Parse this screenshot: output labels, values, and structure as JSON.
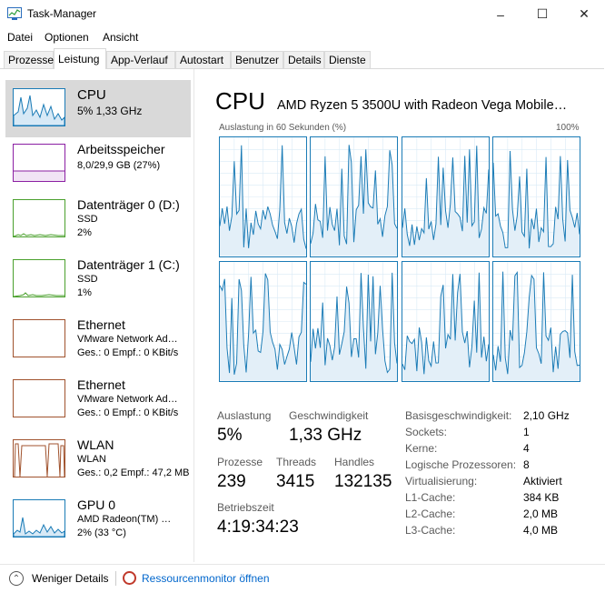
{
  "window": {
    "title": "Task-Manager",
    "controls": [
      "–",
      "☐",
      "✕"
    ]
  },
  "menu": [
    {
      "label": "Datei",
      "access": "D"
    },
    {
      "label": "Optionen",
      "access": "O"
    },
    {
      "label": "Ansicht",
      "access": "A"
    }
  ],
  "tabs": [
    {
      "label": "Prozesse"
    },
    {
      "label": "Leistung",
      "active": true
    },
    {
      "label": "App-Verlauf"
    },
    {
      "label": "Autostart"
    },
    {
      "label": "Benutzer"
    },
    {
      "label": "Details"
    },
    {
      "label": "Dienste"
    }
  ],
  "devices": [
    {
      "title": "CPU",
      "line1": "5% 1,33 GHz",
      "line2": "",
      "color": "#1a7bb6",
      "fill": "#e6f1f9",
      "selected": true
    },
    {
      "title": "Arbeitsspeicher",
      "line1": "8,0/29,9 GB (27%)",
      "line2": "",
      "color": "#8b1fa3",
      "fill": "#f3e5f6"
    },
    {
      "title": "Datenträger 0 (D:)",
      "line1": "SSD",
      "line2": "2%",
      "color": "#4aa02c",
      "fill": "#eef7ea"
    },
    {
      "title": "Datenträger 1 (C:)",
      "line1": "SSD",
      "line2": "1%",
      "color": "#4aa02c",
      "fill": "#eef7ea"
    },
    {
      "title": "Ethernet",
      "line1": "VMware Network Ad…",
      "line2": "Ges.: 0 Empf.: 0 KBit/s",
      "color": "#a0522d",
      "fill": "#fff"
    },
    {
      "title": "Ethernet",
      "line1": "VMware Network Ad…",
      "line2": "Ges.: 0 Empf.: 0 KBit/s",
      "color": "#a0522d",
      "fill": "#fff"
    },
    {
      "title": "WLAN",
      "line1": "WLAN",
      "line2": "Ges.: 0,2 Empf.: 47,2 MB",
      "color": "#a0522d",
      "fill": "#fff"
    },
    {
      "title": "GPU 0",
      "line1": "AMD Radeon(TM) …",
      "line2": "2% (33 °C)",
      "color": "#1a7bb6",
      "fill": "#e6f1f9"
    }
  ],
  "cpu": {
    "title": "CPU",
    "model": "AMD Ryzen 5 3500U with Radeon Vega Mobile…",
    "graph_label": "Auslastung in 60 Sekunden (%)",
    "graph_max": "100%",
    "stats": {
      "usage_label": "Auslastung",
      "usage": "5%",
      "speed_label": "Geschwindigkeit",
      "speed": "1,33 GHz",
      "processes_label": "Prozesse",
      "processes": "239",
      "threads_label": "Threads",
      "threads": "3415",
      "handles_label": "Handles",
      "handles": "132135",
      "uptime_label": "Betriebszeit",
      "uptime": "4:19:34:23"
    },
    "details": [
      {
        "key": "Basisgeschwindigkeit:",
        "value": "2,10 GHz"
      },
      {
        "key": "Sockets:",
        "value": "1"
      },
      {
        "key": "Kerne:",
        "value": "4"
      },
      {
        "key": "Logische Prozessoren:",
        "value": "8"
      },
      {
        "key": "Virtualisierung:",
        "value": "Aktiviert"
      },
      {
        "key": "L1-Cache:",
        "value": "384 KB"
      },
      {
        "key": "L2-Cache:",
        "value": "2,0 MB"
      },
      {
        "key": "L3-Cache:",
        "value": "4,0 MB"
      }
    ]
  },
  "footer": {
    "fewer_details": "Weniger Details",
    "resource_monitor": "Ressourcenmonitor öffnen"
  },
  "colors": {
    "accent": "#1a7bb6",
    "selected_bg": "#d9d9d9",
    "link": "#0066cc"
  }
}
